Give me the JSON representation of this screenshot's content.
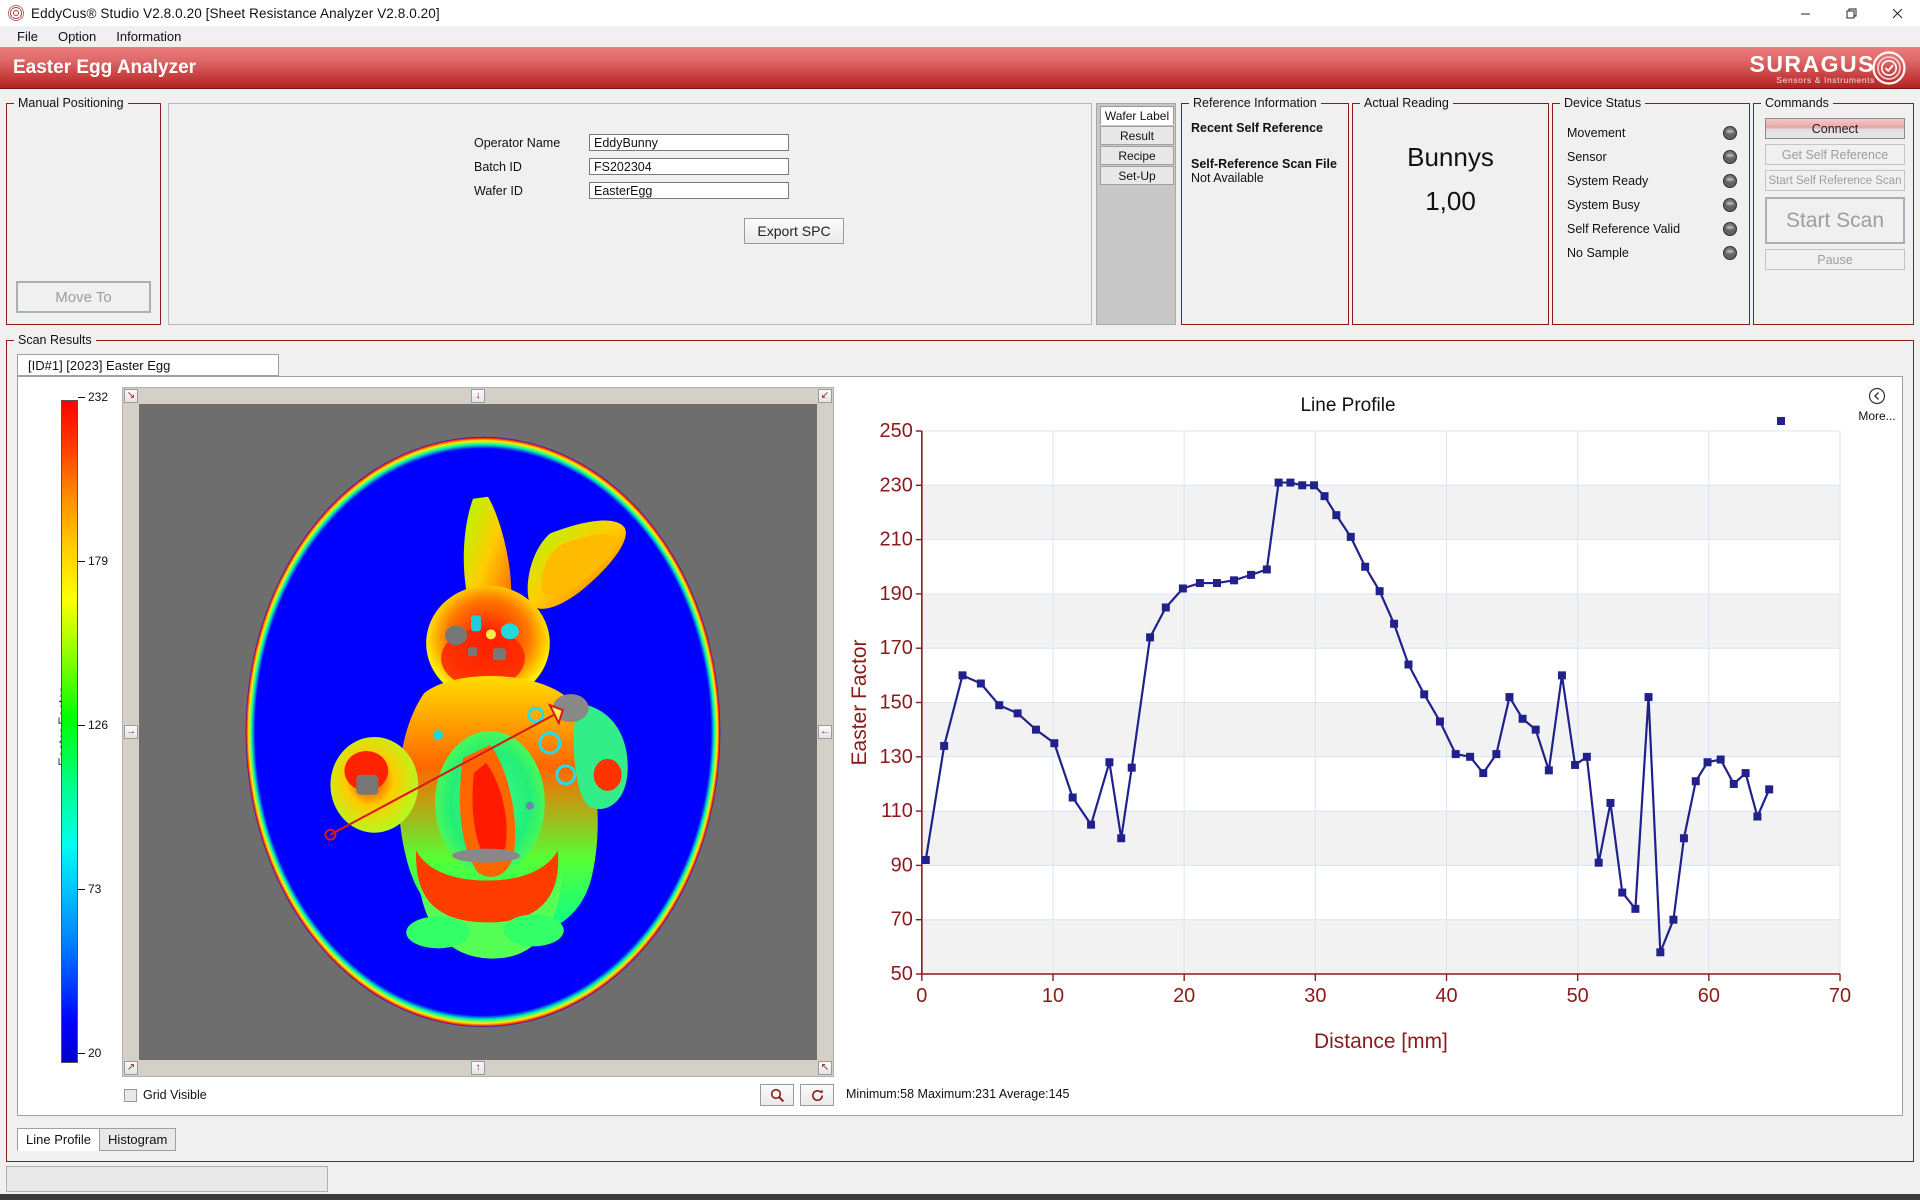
{
  "window": {
    "title": "EddyCus® Studio V2.8.0.20 [Sheet Resistance Analyzer V2.8.0.20]",
    "minimize": "—",
    "maximize": "❐",
    "close": "✕"
  },
  "menubar": {
    "items": [
      "File",
      "Option",
      "Information"
    ]
  },
  "banner": {
    "title": "Easter Egg Analyzer",
    "logo_main": "SURAGUS",
    "logo_sub": "Sensors & Instruments"
  },
  "manual_positioning": {
    "caption": "Manual Positioning",
    "move_to": "Move To"
  },
  "wafer_form": {
    "fields": [
      {
        "label": "Operator Name",
        "value": "EddyBunny"
      },
      {
        "label": "Batch ID",
        "value": "FS202304"
      },
      {
        "label": "Wafer ID",
        "value": "EasterEgg"
      }
    ],
    "export_button": "Export SPC"
  },
  "side_tabs": {
    "items": [
      "Wafer Label",
      "Result",
      "Recipe",
      "Set-Up"
    ],
    "active": "Wafer Label"
  },
  "reference_information": {
    "caption": "Reference Information",
    "recent_self_reference_label": "Recent Self Reference",
    "recent_self_reference_value": "",
    "scan_file_label": "Self-Reference Scan File",
    "scan_file_value": "Not Available"
  },
  "actual_reading": {
    "caption": "Actual Reading",
    "unit": "Bunnys",
    "value": "1,00"
  },
  "device_status": {
    "caption": "Device Status",
    "items": [
      {
        "label": "Movement",
        "state": "off"
      },
      {
        "label": "Sensor",
        "state": "off"
      },
      {
        "label": "System Ready",
        "state": "off"
      },
      {
        "label": "System Busy",
        "state": "off"
      },
      {
        "label": "Self Reference Valid",
        "state": "off"
      },
      {
        "label": "No Sample",
        "state": "off"
      }
    ]
  },
  "commands": {
    "caption": "Commands",
    "connect": "Connect",
    "get_self_reference": "Get Self Reference",
    "start_self_reference_scan": "Start Self Reference Scan",
    "start_scan": "Start Scan",
    "pause": "Pause"
  },
  "scan_results": {
    "caption": "Scan Results",
    "tab_label": "[ID#1] [2023] Easter Egg",
    "grid_visible_label": "Grid Visible",
    "grid_visible_checked": false,
    "statistics": "Minimum:58  Maximum:231  Average:145",
    "zoom_icon": "search-icon",
    "reset_icon": "refresh-icon",
    "bottom_tabs": [
      "Line Profile",
      "Histogram"
    ],
    "bottom_tab_active": "Line Profile"
  },
  "colorbar": {
    "axis_label": "Easter Factor",
    "ticks": [
      232,
      179,
      126,
      73,
      20
    ],
    "colors": [
      "#ff0000",
      "#ffff00",
      "#00ff00",
      "#00ffff",
      "#0000ff"
    ]
  },
  "heatmap": {
    "background": "#6e6e6e",
    "wafer_fill": "#0000ff",
    "profile_line_color": "#d91818",
    "start_marker": "circle",
    "end_marker": "triangle"
  },
  "more_panel": {
    "label": "More...",
    "icon": "chevron-left-circle-icon"
  },
  "chart_data": {
    "type": "line",
    "title": "Line Profile",
    "xlabel": "Distance [mm]",
    "ylabel": "Easter Factor",
    "xlim": [
      0,
      70
    ],
    "ylim": [
      50,
      250
    ],
    "xticks": [
      0,
      10,
      20,
      30,
      40,
      50,
      60,
      70
    ],
    "yticks": [
      50,
      70,
      90,
      110,
      130,
      150,
      170,
      190,
      210,
      230,
      250
    ],
    "grid": true,
    "legend": null,
    "marker": "square",
    "color": "#21218c",
    "series": [
      {
        "name": "Line Profile",
        "x": [
          0.3,
          1.7,
          3.1,
          4.5,
          5.9,
          7.3,
          8.7,
          10.1,
          11.5,
          12.9,
          14.3,
          15.2,
          16.0,
          17.4,
          18.6,
          19.9,
          21.2,
          22.5,
          23.8,
          25.1,
          26.3,
          27.2,
          28.1,
          29.0,
          29.9,
          30.7,
          31.6,
          32.7,
          33.8,
          34.9,
          36.0,
          37.1,
          38.3,
          39.5,
          40.7,
          41.8,
          42.8,
          43.8,
          44.8,
          45.8,
          46.8,
          47.8,
          48.8,
          49.8,
          50.7,
          51.6,
          52.5,
          53.4,
          54.4,
          55.4,
          56.3,
          57.3,
          58.1,
          59.0,
          59.9,
          60.9,
          61.9,
          62.8,
          63.7,
          64.6,
          65.5
        ],
        "values": [
          92,
          134,
          160,
          157,
          149,
          146,
          140,
          135,
          115,
          105,
          128,
          100,
          126,
          174,
          185,
          192,
          194,
          194,
          195,
          197,
          199,
          231,
          231,
          230,
          230,
          226,
          219,
          211,
          200,
          191,
          179,
          164,
          153,
          143,
          131,
          130,
          124,
          131,
          152,
          144,
          140,
          125,
          160,
          127,
          130,
          91,
          113,
          80,
          74,
          152,
          58,
          70,
          100,
          121,
          128,
          129,
          120,
          124,
          108,
          118
        ]
      }
    ]
  }
}
